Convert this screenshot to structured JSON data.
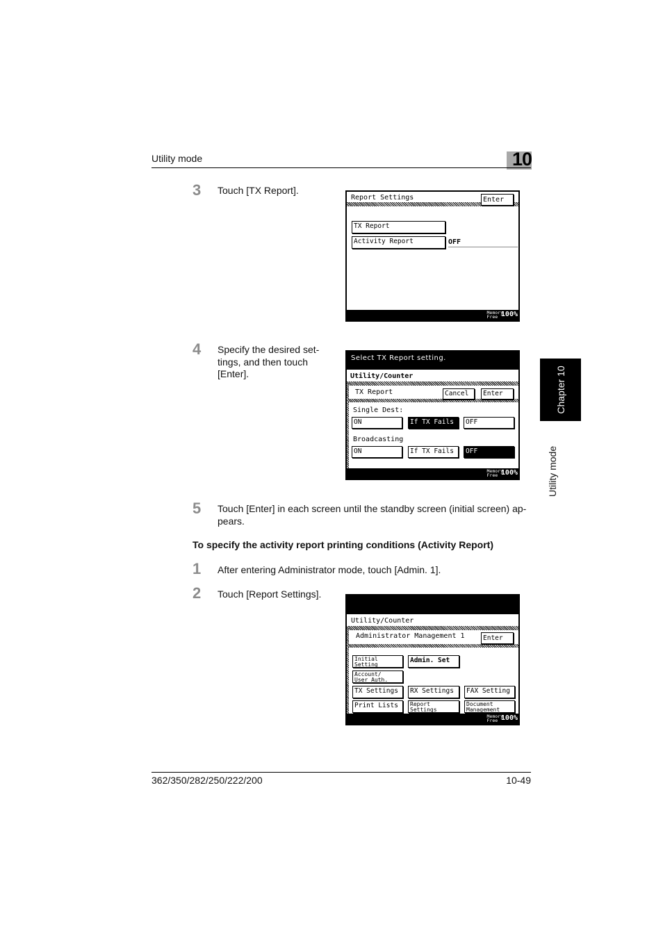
{
  "header": {
    "title": "Utility mode",
    "chapter_number": "10"
  },
  "side_tab": {
    "chapter_label": "Chapter 10",
    "mode_label": "Utility mode"
  },
  "steps_a": [
    {
      "num": "3",
      "text": "Touch [TX Report]."
    },
    {
      "num": "4",
      "text": "Specify the desired set-tings, and then touch [Enter]."
    },
    {
      "num": "5",
      "text": "Touch [Enter] in each screen until the standby screen (initial screen) ap-pears."
    }
  ],
  "section_title": "To specify the activity report printing conditions (Activity Report)",
  "steps_b": [
    {
      "num": "1",
      "text": "After entering Administrator mode, touch [Admin. 1]."
    },
    {
      "num": "2",
      "text": "Touch [Report Settings]."
    }
  ],
  "screen1": {
    "title": "Report Settings",
    "enter": "Enter",
    "buttons": [
      "TX Report",
      "Activity Report"
    ],
    "activity_value": "OFF",
    "memory_label_1": "Memory",
    "memory_label_2": "Free",
    "memory_pct": "100%"
  },
  "screen2": {
    "message": "Select TX Report setting.",
    "breadcrumb": "Utility/Counter",
    "title": "TX Report",
    "cancel": "Cancel",
    "enter": "Enter",
    "single_dest_label": "Single Dest:",
    "single_dest_options": [
      "ON",
      "If TX Fails",
      "OFF"
    ],
    "single_dest_selected": "If TX Fails",
    "broadcasting_label": "Broadcasting",
    "broadcasting_options": [
      "ON",
      "If TX Fails",
      "OFF"
    ],
    "broadcasting_selected": "OFF",
    "memory_label_1": "Memory",
    "memory_label_2": "Free",
    "memory_pct": "100%"
  },
  "screen3": {
    "breadcrumb": "Utility/Counter",
    "title": "Administrator Management 1",
    "enter": "Enter",
    "buttons": [
      {
        "line1": "Initial",
        "line2": "Setting"
      },
      {
        "line1": "Admin. Set",
        "line2": ""
      },
      {
        "line1": "Account/",
        "line2": "User Auth."
      },
      {
        "line1": "TX Settings",
        "line2": ""
      },
      {
        "line1": "RX Settings",
        "line2": ""
      },
      {
        "line1": "FAX Setting",
        "line2": ""
      },
      {
        "line1": "Print Lists",
        "line2": ""
      },
      {
        "line1": "Report",
        "line2": "Settings"
      },
      {
        "line1": "Document",
        "line2": "Management"
      }
    ],
    "memory_label_1": "Memory",
    "memory_label_2": "Free",
    "memory_pct": "100%"
  },
  "footer": {
    "models": "362/350/282/250/222/200",
    "page": "10-49"
  }
}
